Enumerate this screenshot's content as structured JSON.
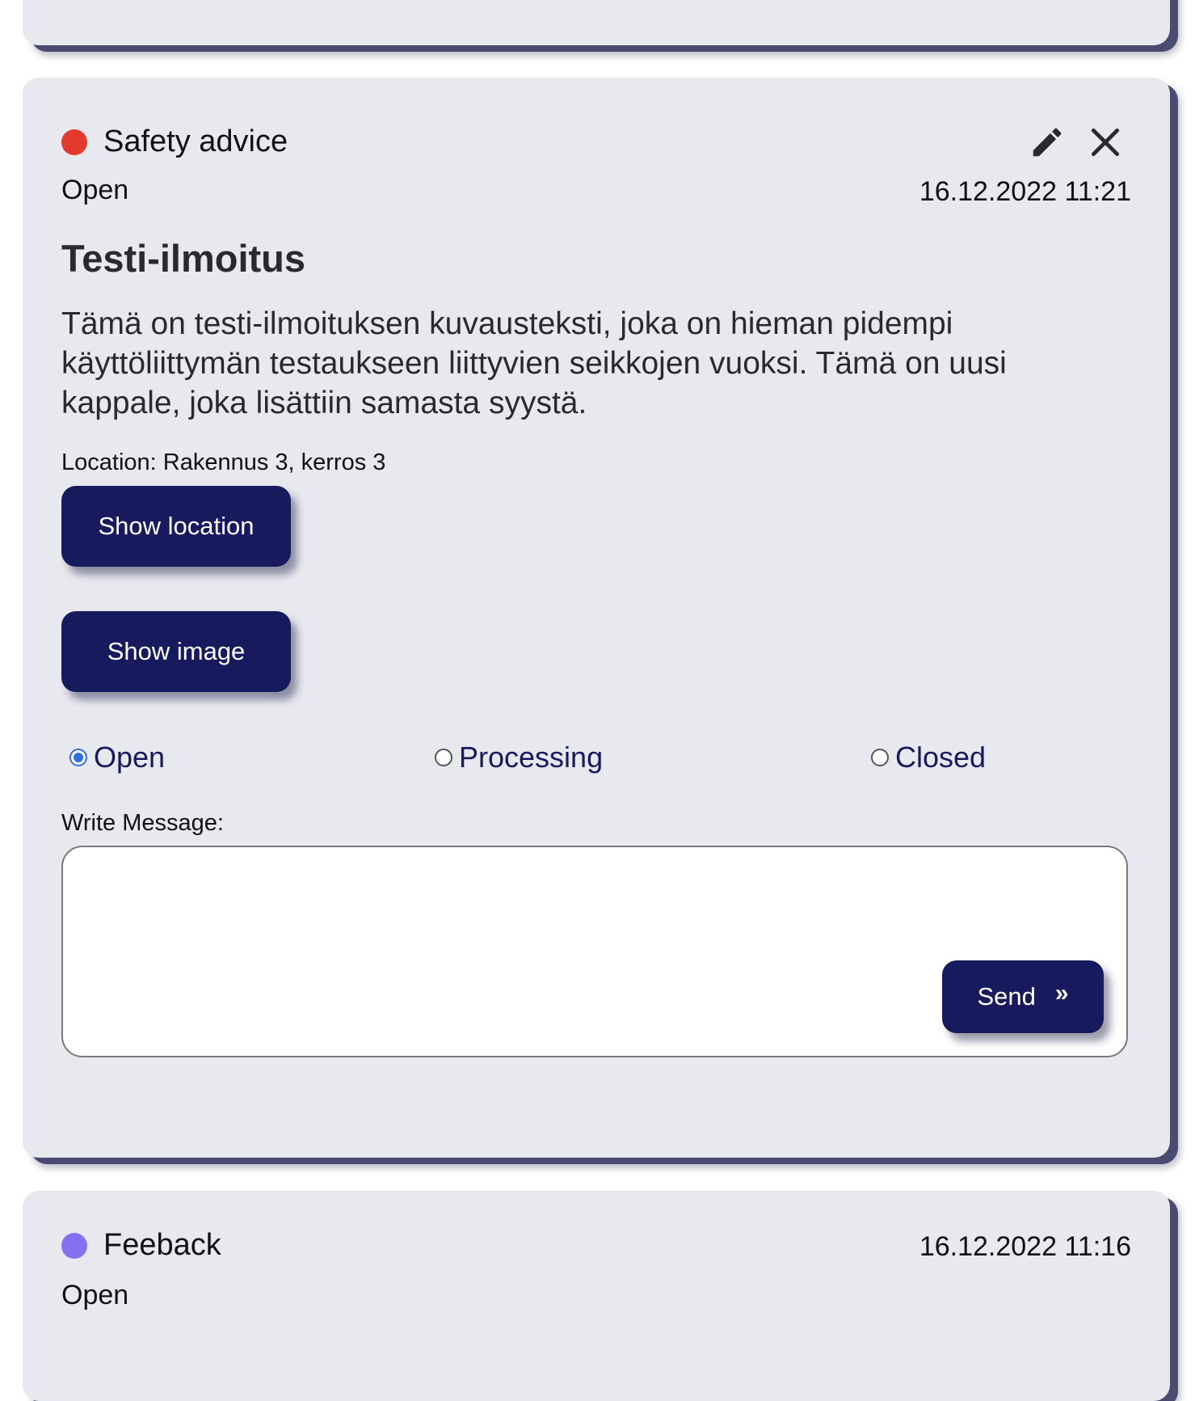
{
  "cards": [
    {},
    {
      "category": "Safety advice",
      "category_color": "#e23a2c",
      "status": "Open",
      "timestamp": "16.12.2022 11:21",
      "title": "Testi-ilmoitus",
      "description": "Tämä on testi-ilmoituksen kuvausteksti, joka on hieman pidempi käyttöliittymän testaukseen liittyvien seikkojen vuoksi. Tämä on uusi kappale, joka lisättiin samasta syystä.",
      "location": "Location: Rakennus 3, kerros 3",
      "show_location_label": "Show location",
      "show_image_label": "Show image",
      "edit_icon": "pencil-icon",
      "close_icon": "close-icon",
      "status_options": [
        {
          "label": "Open",
          "selected": true
        },
        {
          "label": "Processing",
          "selected": false
        },
        {
          "label": "Closed",
          "selected": false
        }
      ],
      "message_label": "Write Message:",
      "message_value": "",
      "send_label": "Send",
      "send_icon": "double-chevron-right-icon"
    },
    {
      "category": "Feeback",
      "category_color": "#8470f0",
      "status": "Open",
      "timestamp": "16.12.2022 11:16"
    }
  ],
  "colors": {
    "card_bg": "#e8e9ef",
    "button_bg": "#171b5e",
    "radio_accent": "#2f6fe0",
    "card_shadow": "#4b4b72"
  }
}
